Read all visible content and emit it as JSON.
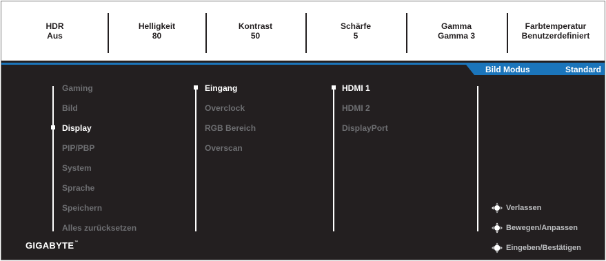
{
  "status_bar": [
    {
      "label": "HDR",
      "value": "Aus"
    },
    {
      "label": "Helligkeit",
      "value": "80"
    },
    {
      "label": "Kontrast",
      "value": "50"
    },
    {
      "label": "Schärfe",
      "value": "5"
    },
    {
      "label": "Gamma",
      "value": "Gamma 3"
    },
    {
      "label": "Farbtemperatur",
      "value": "Benutzerdefiniert"
    }
  ],
  "mode": {
    "label": "Bild Modus",
    "value": "Standard"
  },
  "main_menu": [
    "Gaming",
    "Bild",
    "Display",
    "PIP/PBP",
    "System",
    "Sprache",
    "Speichern",
    "Alles zurücksetzen"
  ],
  "sub_menu": [
    "Eingang",
    "Overclock",
    "RGB Bereich",
    "Overscan"
  ],
  "input_menu": [
    "HDMI 1",
    "HDMI 2",
    "DisplayPort"
  ],
  "selected": {
    "main_menu": "Display",
    "sub_menu": "Eingang",
    "input_menu": "HDMI 1"
  },
  "brand": "GIGABYTE",
  "hints": [
    {
      "label": "Verlassen",
      "icon": "joystick-left-icon"
    },
    {
      "label": "Bewegen/Anpassen",
      "icon": "joystick-updown-icon"
    },
    {
      "label": "Eingeben/Bestätigen",
      "icon": "joystick-press-icon"
    }
  ],
  "colors": {
    "background": "#231f20",
    "accent": "#1b75bb",
    "active_text": "#ffffff",
    "inactive_text": "#6d6e71"
  }
}
